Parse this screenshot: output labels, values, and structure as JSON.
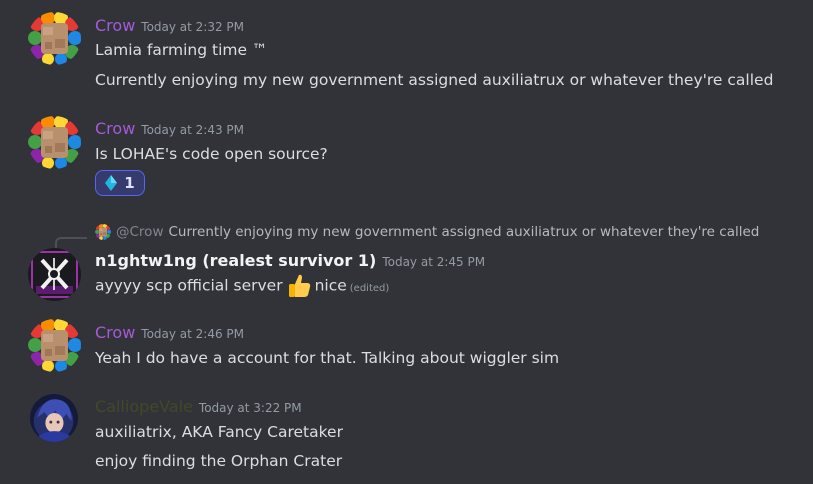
{
  "colors": {
    "crow": "#a45bd6",
    "calliope": "#3f4a27",
    "nightwing": "#f2f3f5",
    "reaction_bg": "#373a6d",
    "reaction_border": "#5865f2"
  },
  "messages": [
    {
      "author": "Crow",
      "time": "Today at 2:32 PM",
      "lines": [
        "Lamia farming time ™",
        "Currently enjoying my new government assigned auxiliatrux or whatever they're called"
      ]
    },
    {
      "author": "Crow",
      "time": "Today at 2:43 PM",
      "lines": [
        "Is LOHAE's code open source?"
      ],
      "reaction": {
        "icon": "diamond-icon",
        "count": "1"
      }
    },
    {
      "reply": {
        "mention": "@Crow",
        "text": "Currently enjoying my new government assigned auxiliatrux or whatever they're called"
      },
      "author": "n1ghtw1ng (realest survivor 1)",
      "time": "Today at 2:45 PM",
      "text_before": "ayyyy scp official server",
      "emoji": "thumbs-up-icon",
      "text_after": "nice",
      "edited": "(edited)"
    },
    {
      "author": "Crow",
      "time": "Today at 2:46 PM",
      "lines": [
        "Yeah I do have a account for that. Talking about wiggler sim"
      ]
    },
    {
      "author": "CalliopeVale",
      "time": "Today at 3:22 PM",
      "lines": [
        "auxiliatrix, AKA Fancy Caretaker",
        "enjoy finding the Orphan Crater"
      ]
    }
  ]
}
